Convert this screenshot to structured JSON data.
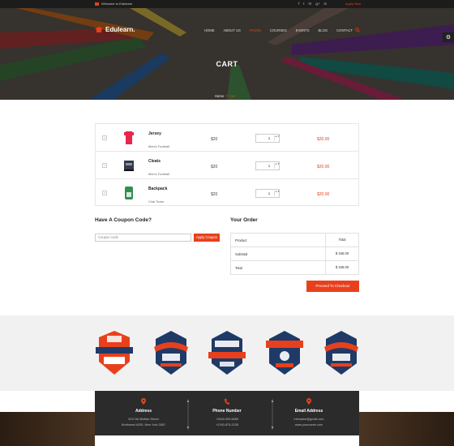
{
  "topbar": {
    "welcome": "Welcome to Edulearn",
    "social": [
      "f",
      "t",
      "✉",
      "g+",
      "in"
    ],
    "apply": "Apply Now"
  },
  "header": {
    "logo": "Edulearn.",
    "nav": [
      "HOME",
      "ABOUT US",
      "PAGES",
      "COURSES",
      "EVENTS",
      "BLOG",
      "CONTACT"
    ],
    "active_nav": "PAGES",
    "page_title": "CART",
    "breadcrumb": {
      "home": "Home",
      "separator": "//",
      "current": "Cart"
    }
  },
  "cart": {
    "items": [
      {
        "remove": "×",
        "name": "Jersey",
        "category": "Men's Football",
        "price": "$20",
        "qty": "1",
        "total": "$20.00",
        "thumb_color": "#e8274b"
      },
      {
        "remove": "×",
        "name": "Cleats",
        "category": "Men's Football",
        "price": "$20",
        "qty": "1",
        "total": "$20.00",
        "thumb_color": "#333a48"
      },
      {
        "remove": "×",
        "name": "Backpack",
        "category": "Club Team",
        "price": "$20",
        "qty": "1",
        "total": "$20.00",
        "thumb_color": "#2f8f55"
      }
    ]
  },
  "coupon": {
    "title": "Have A Coupon Code?",
    "placeholder": "Coupon code",
    "button": "Apply Coupon"
  },
  "order": {
    "title": "Your Order",
    "head_label": "Product",
    "head_value": "Total",
    "subtotal_label": "Subtotal",
    "subtotal_value": "$ 158.00",
    "total_label": "Total",
    "total_value": "$ 158.00",
    "checkout": "Proceed To Checkout"
  },
  "contact": {
    "address": {
      "title": "Address",
      "line1": "503 Old Buffalo Street",
      "line2": "Northwest #205, New York-3087"
    },
    "phone": {
      "title": "Phone Number",
      "line1": "+3453-909-6565",
      "line2": "+2190-875-2235"
    },
    "email": {
      "title": "Email Address",
      "line1": "infoname@gmail.com",
      "line2": "www.yourname.com"
    }
  },
  "colors": {
    "accent": "#e8401c",
    "navy": "#1f3a66",
    "dark": "#2b2b2b"
  }
}
